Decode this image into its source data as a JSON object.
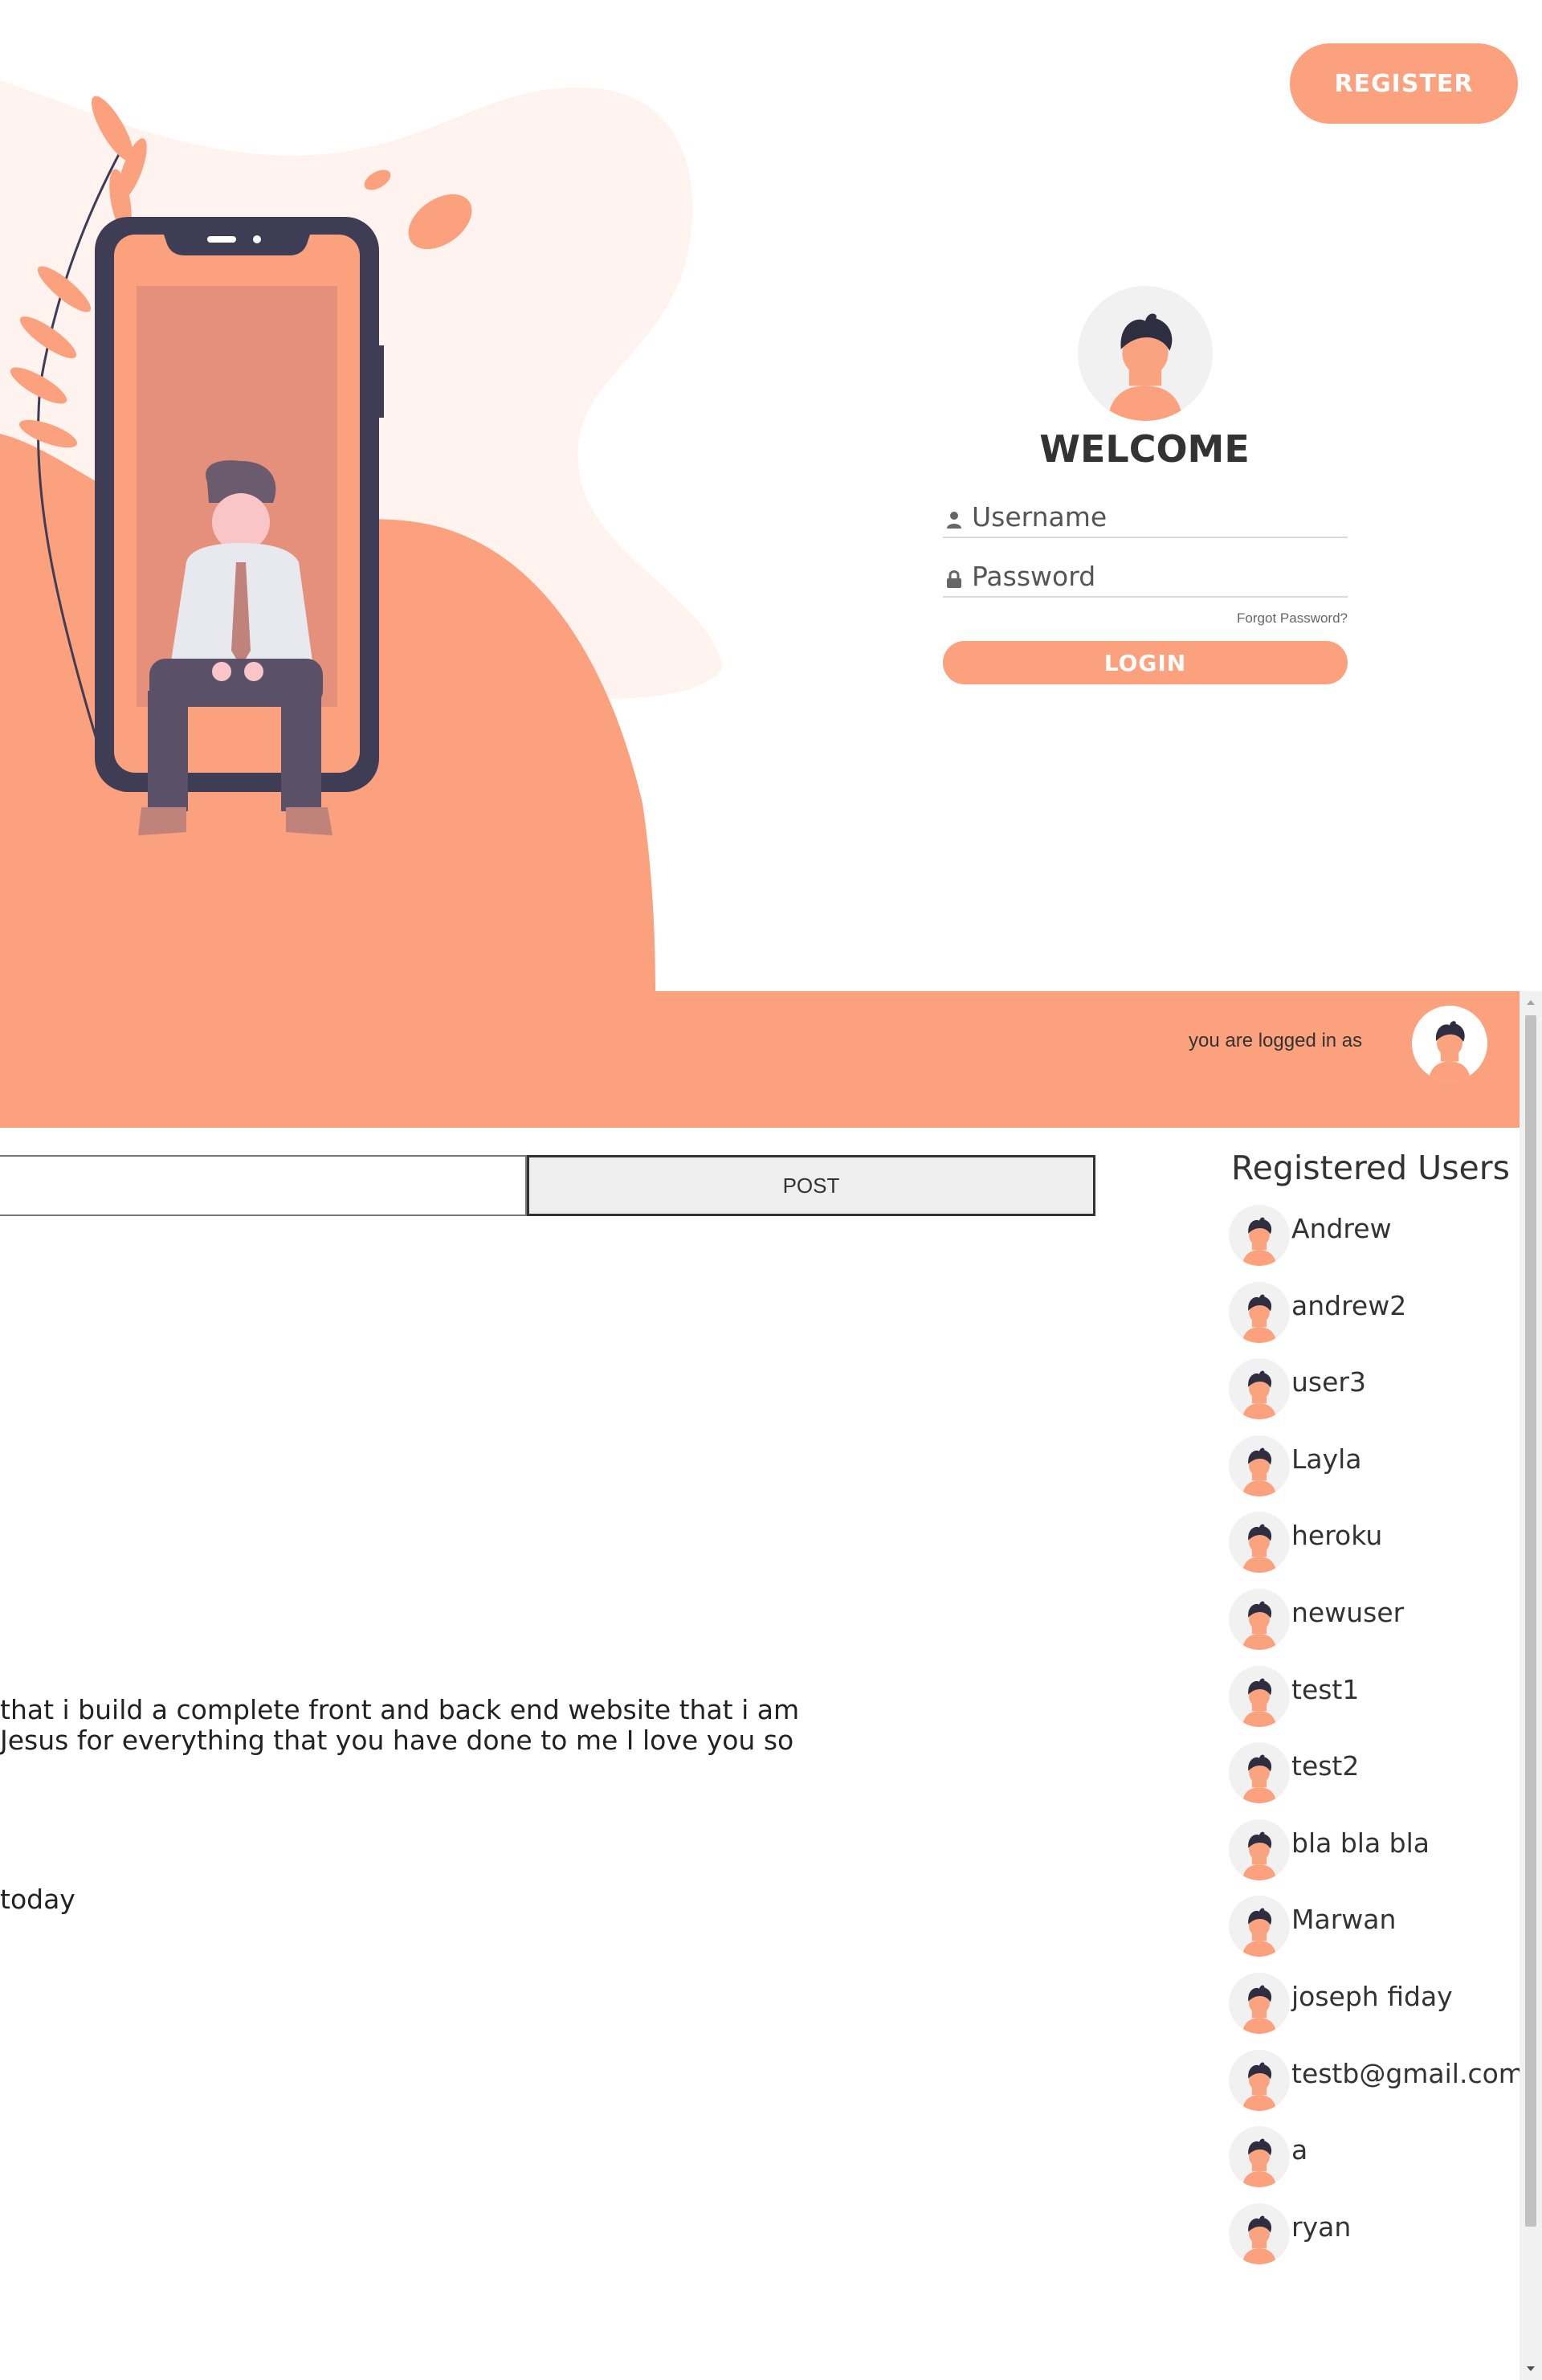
{
  "header": {
    "register_label": "REGISTER"
  },
  "login": {
    "title": "WELCOME",
    "username_placeholder": "Username",
    "password_placeholder": "Password",
    "forgot_label": "Forgot Password?",
    "login_label": "LOGIN"
  },
  "app_header": {
    "logged_in_label": "you are logged in as"
  },
  "composer": {
    "post_label": "POST",
    "input_value": ""
  },
  "feed": {
    "posts": [
      {
        "line1": "that i build a complete front and back end website that i am",
        "line2": "Jesus for everything that you have done to me I love you so"
      },
      {
        "line1": "today"
      }
    ]
  },
  "users_panel": {
    "title": "Registered Users",
    "users": [
      "Andrew",
      "andrew2",
      "user3",
      "Layla",
      "heroku",
      "newuser",
      "test1",
      "test2",
      "bla bla bla",
      "Marwan",
      "joseph fiday",
      "testb@gmail.com",
      "a",
      "ryan"
    ]
  },
  "colors": {
    "accent": "#fca17d",
    "blob_light": "#fff3ef",
    "phone_frame": "#3f3d56"
  },
  "icons": {
    "username": "user-icon",
    "password": "lock-icon",
    "avatar": "avatar-icon"
  }
}
